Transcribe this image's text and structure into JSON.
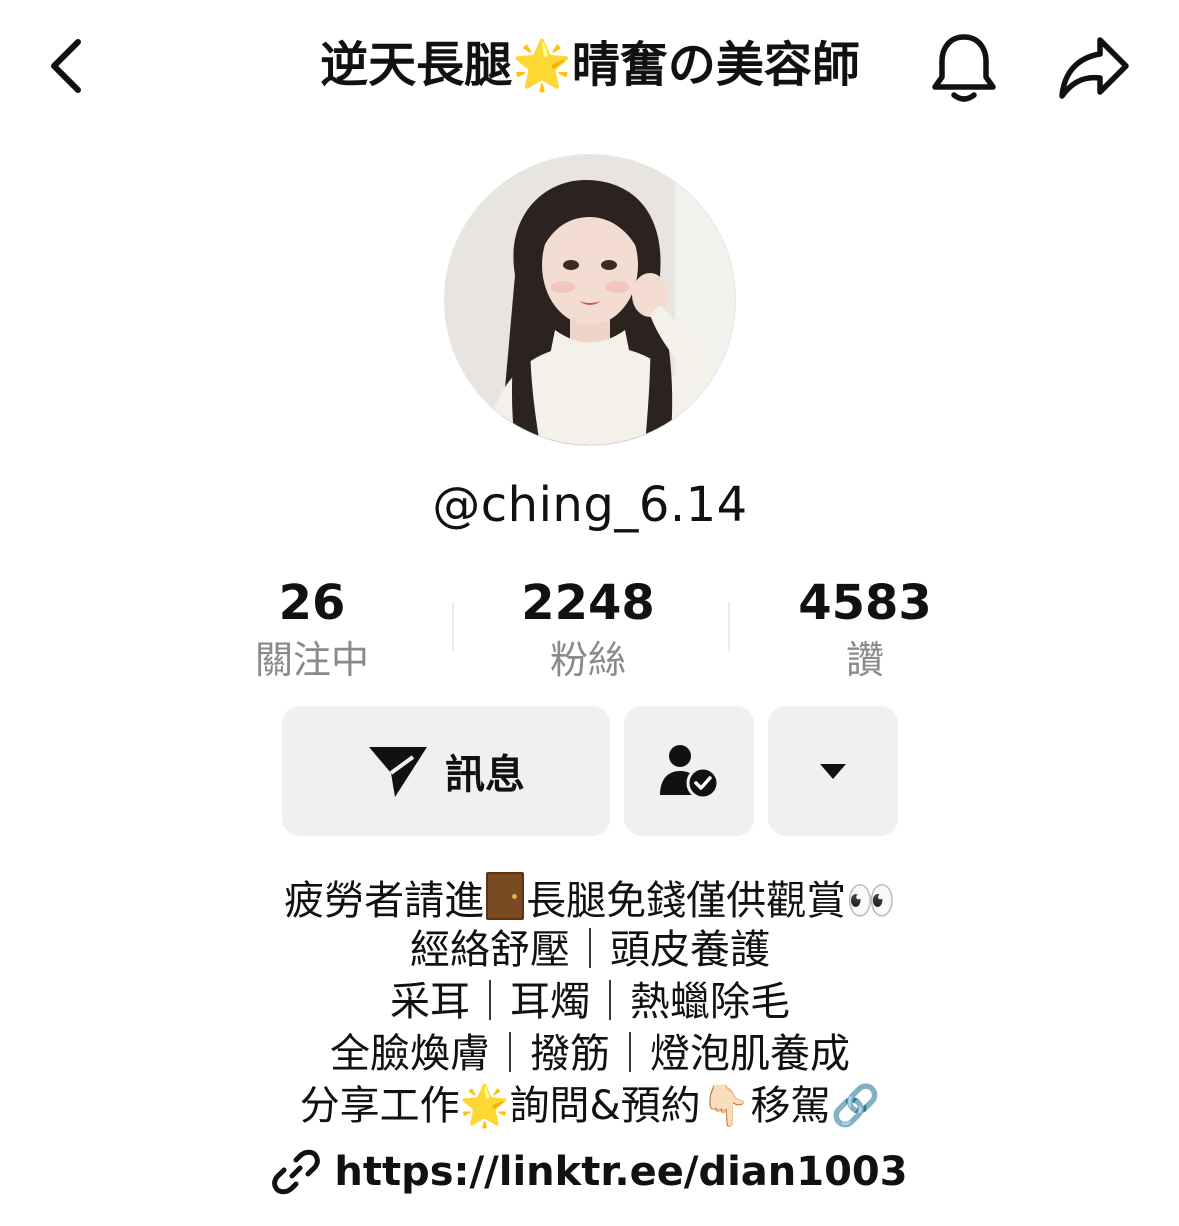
{
  "header": {
    "title": "逆天長腿🌟晴奮の美容師",
    "back_icon": "chevron-left-icon",
    "bell_icon": "bell-icon",
    "share_icon": "share-arrow-icon"
  },
  "profile": {
    "username": "@ching_6.14",
    "avatar": "profile-photo"
  },
  "stats": [
    {
      "value": "26",
      "label": "關注中"
    },
    {
      "value": "2248",
      "label": "粉絲"
    },
    {
      "value": "4583",
      "label": "讚"
    }
  ],
  "actions": {
    "message_label": "訊息",
    "message_icon": "send-icon",
    "follow_status_icon": "user-check-icon",
    "more_icon": "caret-down-icon"
  },
  "bio": {
    "line1_a": "疲勞者請進",
    "line1_b": "長腿免錢僅供觀賞👀",
    "line2": "經絡舒壓｜頭皮養護",
    "line3": "采耳｜耳燭｜熱蠟除毛",
    "line4": "全臉煥膚｜撥筋｜燈泡肌養成",
    "line5": "分享工作🌟詢問&預約👇🏻移駕🔗"
  },
  "link": {
    "url": "https://linktr.ee/dian1003",
    "icon": "link-icon"
  }
}
